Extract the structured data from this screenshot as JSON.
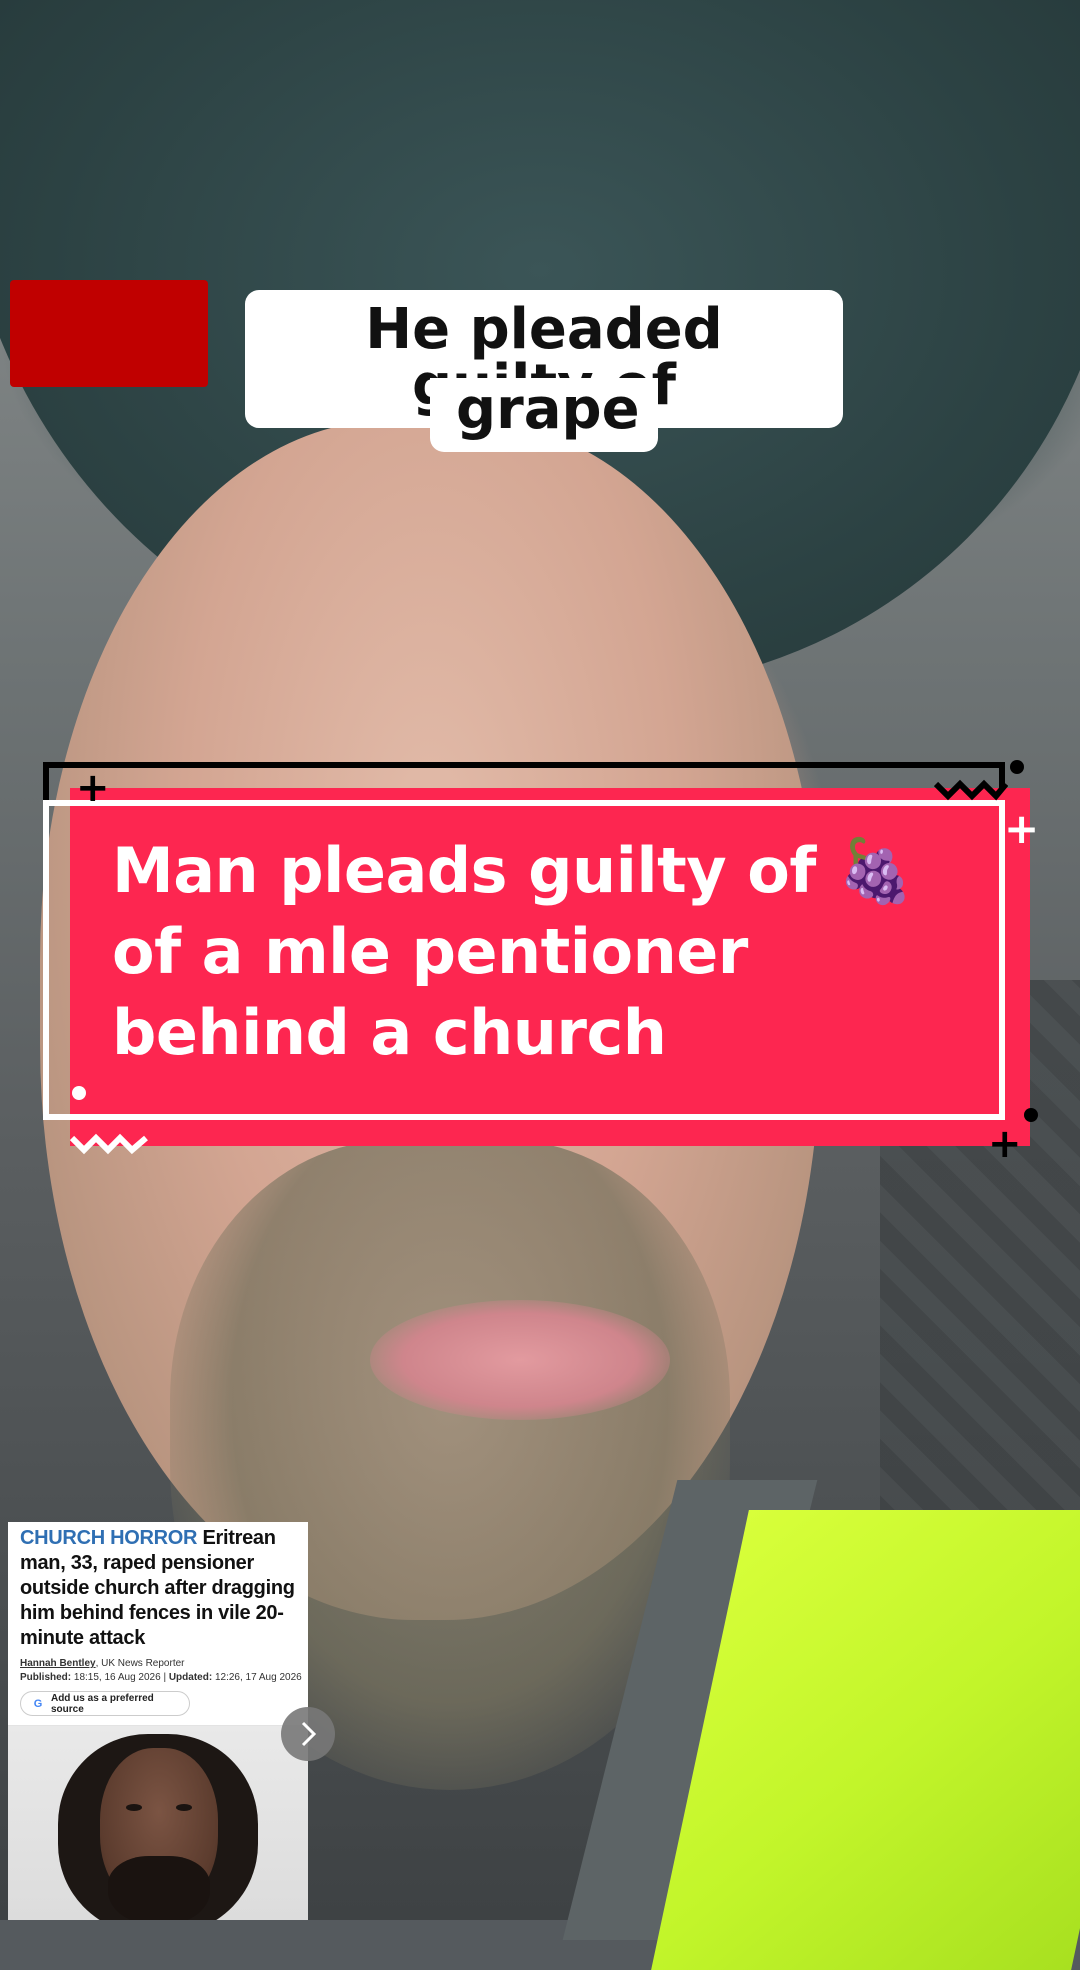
{
  "caption": {
    "line1": "He pleaded guilty of",
    "line2": "grape"
  },
  "sticker": {
    "headline": "Man pleads guilty of 🍇 of a mle pentioner behind a church",
    "accent_color": "#fd2650"
  },
  "red_box_color": "#c00000",
  "news_card": {
    "kicker": "CHURCH HORROR",
    "headline": "Eritrean man, 33, raped pensioner outside church after dragging him behind fences in vile 20-minute attack",
    "author": "Hannah Bentley",
    "author_role": ", UK News Reporter",
    "published_label": "Published:",
    "published": "18:15, 16 Aug 2026",
    "separator": "|",
    "updated_label": "Updated:",
    "updated": "12:26, 17 Aug 2026",
    "preferred_source_label": "Add us as a preferred source",
    "google_glyph": "G",
    "kicker_color": "#2f6fb3"
  }
}
